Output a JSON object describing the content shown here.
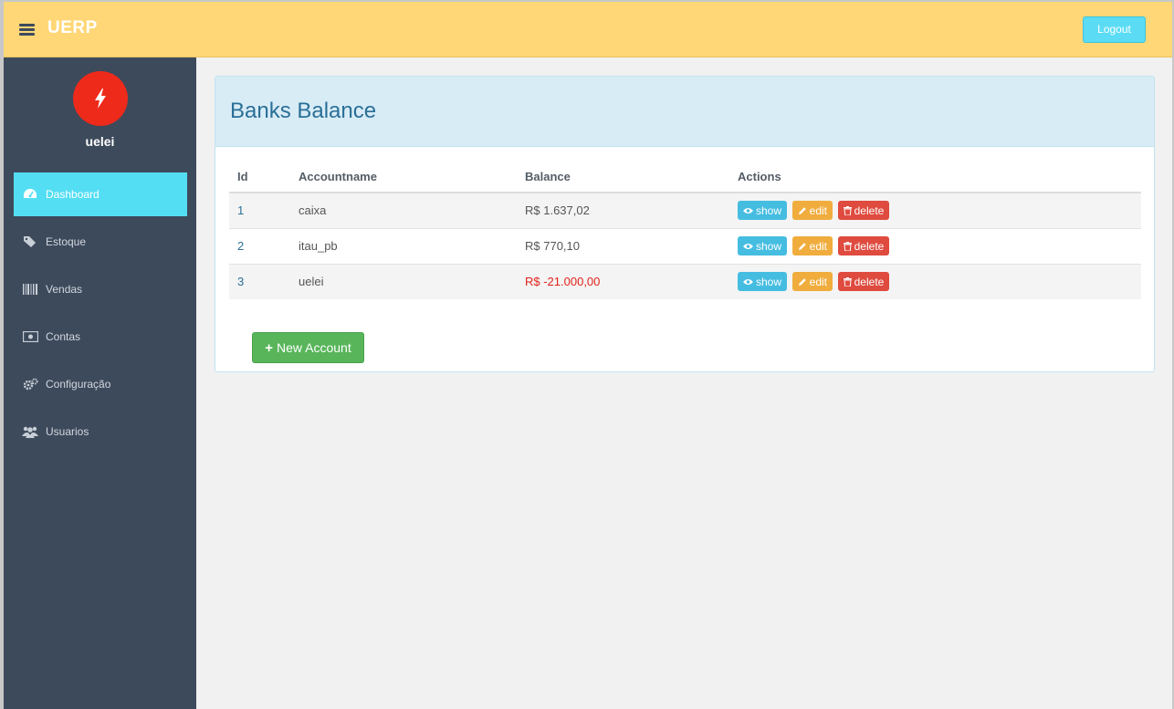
{
  "header": {
    "brand": "UERP",
    "logout_label": "Logout",
    "background": "#ffd776"
  },
  "sidebar": {
    "username": "uelei",
    "avatar_icon": "lightning-bolt-icon",
    "items": [
      {
        "label": "Dashboard",
        "icon": "dashboard-icon",
        "active": true
      },
      {
        "label": "Estoque",
        "icon": "tags-icon"
      },
      {
        "label": "Vendas",
        "icon": "barcode-icon"
      },
      {
        "label": "Contas",
        "icon": "money-icon"
      },
      {
        "label": "Configuração",
        "icon": "cogs-icon"
      },
      {
        "label": "Usuarios",
        "icon": "users-icon"
      }
    ]
  },
  "main": {
    "title": "Banks Balance",
    "columns": [
      "Id",
      "Accountname",
      "Balance",
      "Actions"
    ],
    "rows": [
      {
        "id": "1",
        "name": "caixa",
        "balance": "R$ 1.637,02"
      },
      {
        "id": "2",
        "name": "itau_pb",
        "balance": "R$ 770,10"
      },
      {
        "id": "3",
        "name": "uelei",
        "balance": "R$ -21.000,00"
      }
    ],
    "actions": {
      "show": "show",
      "edit": "edit",
      "delete": "delete"
    },
    "new_account_label": "New Account"
  },
  "colors": {
    "sidebar": "#3d4a5c",
    "active_nav": "#54def3",
    "negative": "#e2231a",
    "show": "#45bde0",
    "edit": "#f0ad3e",
    "delete": "#df4b3f",
    "new": "#58b55a"
  }
}
